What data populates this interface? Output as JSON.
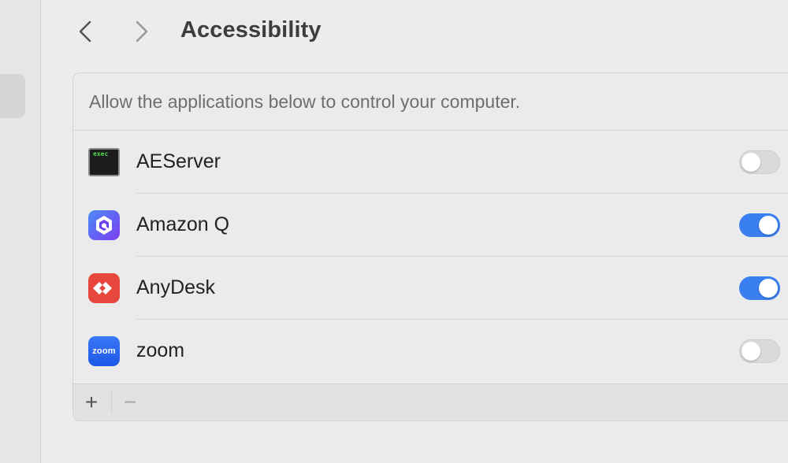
{
  "header": {
    "title": "Accessibility",
    "back_icon": "chevron-left-icon",
    "forward_icon": "chevron-right-icon"
  },
  "panel": {
    "description": "Allow the applications below to control your computer."
  },
  "apps": [
    {
      "name": "AEServer",
      "icon": "exec-terminal-icon",
      "icon_text": "exec",
      "enabled": false
    },
    {
      "name": "Amazon Q",
      "icon": "amazon-q-icon",
      "enabled": true
    },
    {
      "name": "AnyDesk",
      "icon": "anydesk-icon",
      "enabled": true
    },
    {
      "name": "zoom",
      "icon": "zoom-icon",
      "icon_text": "zoom",
      "enabled": false
    }
  ],
  "footer": {
    "add_label": "+",
    "remove_label": "−"
  },
  "colors": {
    "toggle_on": "#3a7ff0",
    "toggle_off": "#dadada",
    "amazon_q": "#6a3df0",
    "anydesk": "#e8473d",
    "zoom": "#2b6af5"
  }
}
